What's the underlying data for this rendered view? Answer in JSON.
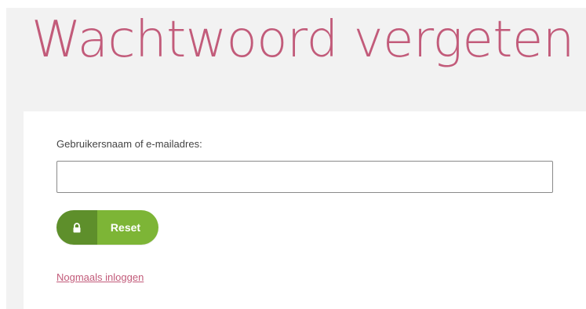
{
  "page": {
    "title": "Wachtwoord vergeten"
  },
  "form": {
    "username_label": "Gebruikersnaam of e-mailadres:",
    "username_value": "",
    "reset_label": "Reset",
    "reset_icon": "lock-icon",
    "relogin_link": "Nogmaals inloggen"
  },
  "colors": {
    "title": "#c25b7a",
    "link": "#c25b7a",
    "button_dark": "#5e8f2b",
    "button_light": "#7db536",
    "background_band": "#f2f2f2"
  }
}
